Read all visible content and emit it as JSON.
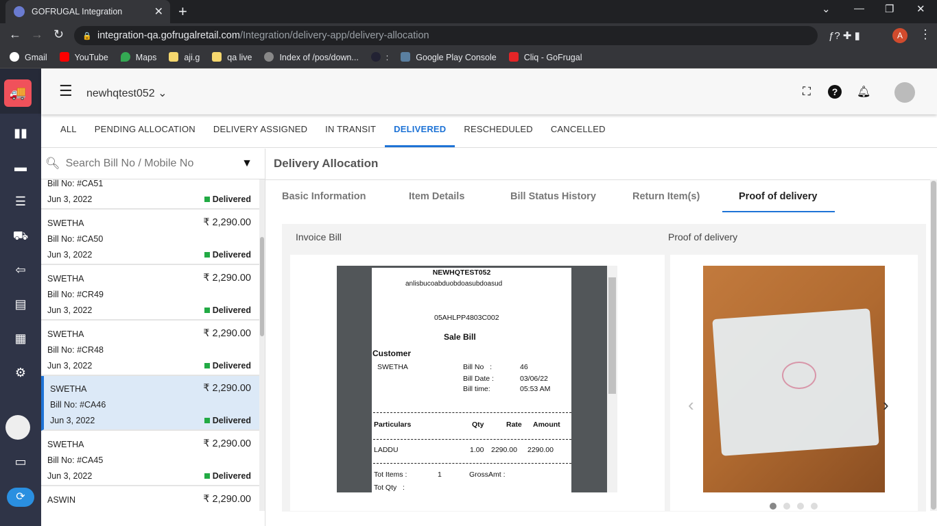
{
  "browser": {
    "tab_title": "GOFRUGAL Integration",
    "url_host": "integration-qa.gofrugalretail.com",
    "url_path": "/Integration/delivery-app/delivery-allocation",
    "bookmarks": [
      "Gmail",
      "YouTube",
      "Maps",
      "aji.g",
      "qa live",
      "Index of /pos/down...",
      ":",
      "Google Play Console",
      "Cliq - GoFrugal"
    ]
  },
  "header": {
    "store": "newhqtest052"
  },
  "tabs": [
    "ALL",
    "PENDING ALLOCATION",
    "DELIVERY ASSIGNED",
    "IN TRANSIT",
    "DELIVERED",
    "RESCHEDULED",
    "CANCELLED"
  ],
  "search": {
    "placeholder": "Search Bill No / Mobile No"
  },
  "list": [
    {
      "name": "",
      "bill": "Bill No: #CA51",
      "date": "Jun 3, 2022",
      "amount": "",
      "status": "Delivered"
    },
    {
      "name": "SWETHA",
      "bill": "Bill No: #CA50",
      "date": "Jun 3, 2022",
      "amount": "₹ 2,290.00",
      "status": "Delivered"
    },
    {
      "name": "SWETHA",
      "bill": "Bill No: #CR49",
      "date": "Jun 3, 2022",
      "amount": "₹ 2,290.00",
      "status": "Delivered"
    },
    {
      "name": "SWETHA",
      "bill": "Bill No: #CR48",
      "date": "Jun 3, 2022",
      "amount": "₹ 2,290.00",
      "status": "Delivered"
    },
    {
      "name": "SWETHA",
      "bill": "Bill No: #CA46",
      "date": "Jun 3, 2022",
      "amount": "₹ 2,290.00",
      "status": "Delivered"
    },
    {
      "name": "SWETHA",
      "bill": "Bill No: #CA45",
      "date": "Jun 3, 2022",
      "amount": "₹ 2,290.00",
      "status": "Delivered"
    },
    {
      "name": "ASWIN",
      "bill": "",
      "date": "",
      "amount": "₹ 2,290.00",
      "status": ""
    }
  ],
  "detail": {
    "title": "Delivery Allocation",
    "subtabs": [
      "Basic Information",
      "Item Details",
      "Bill Status History",
      "Return Item(s)",
      "Proof of delivery"
    ],
    "invoice_label": "Invoice Bill",
    "pod_label": "Proof of delivery"
  },
  "bill": {
    "store": "NEWHQTEST052",
    "address": "anlisbucoabduobdoasubdoasud",
    "gstin": "05AHLPP4803C002",
    "type": "Sale Bill",
    "customer_label": "Customer",
    "customer": "SWETHA",
    "bill_no_label": "Bill No   :",
    "bill_no": "46",
    "bill_date_label": "Bill Date :",
    "bill_date": "03/06/22",
    "bill_time_label": "Bill time:",
    "bill_time": "05:53 AM",
    "cols": [
      "Particulars",
      "Qty",
      "Rate",
      "Amount"
    ],
    "item": [
      "LADDU",
      "1.00",
      "2290.00",
      "2290.00"
    ],
    "tot_items_label": "Tot Items :",
    "tot_items": "1",
    "gross_label": "GrossAmt :",
    "tot_qty_label": "Tot Qty   :"
  }
}
